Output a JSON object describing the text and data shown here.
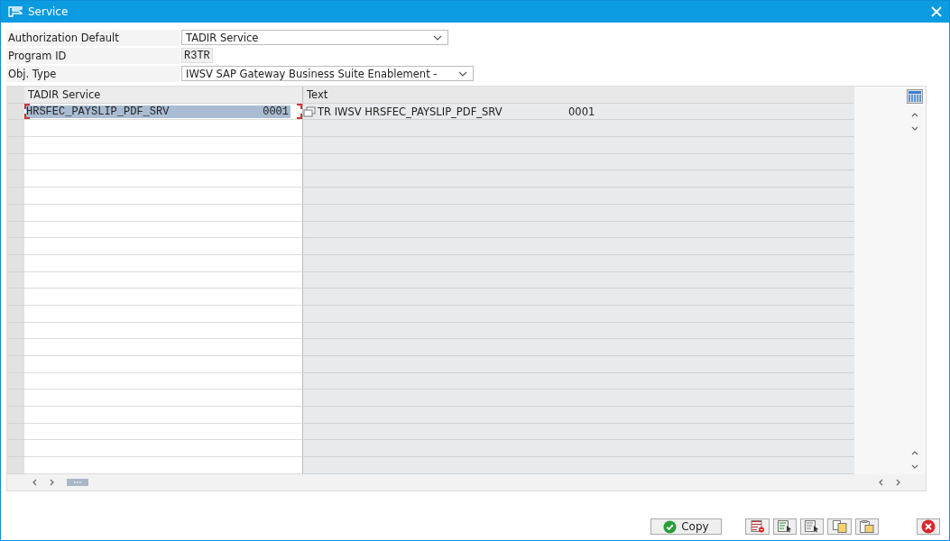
{
  "window": {
    "title": "Service"
  },
  "form": [
    {
      "label": "Authorization Default",
      "value": "TADIR Service",
      "kind": "dropdown"
    },
    {
      "label": "Program ID",
      "value": "R3TR",
      "kind": "display"
    },
    {
      "label": "Obj. Type",
      "value": "IWSV SAP Gateway Business Suite Enablement -",
      "kind": "dropdown"
    }
  ],
  "table": {
    "columns": [
      "TADIR Service",
      "Text"
    ],
    "rows": [
      {
        "service": "HRSFEC_PAYSLIP_PDF_SRV",
        "service_number": "0001",
        "text": "TR IWSV HRSFEC_PAYSLIP_PDF_SRV",
        "text_number": "0001",
        "selected": true
      }
    ]
  },
  "buttons": [
    {
      "label": "Copy"
    }
  ]
}
